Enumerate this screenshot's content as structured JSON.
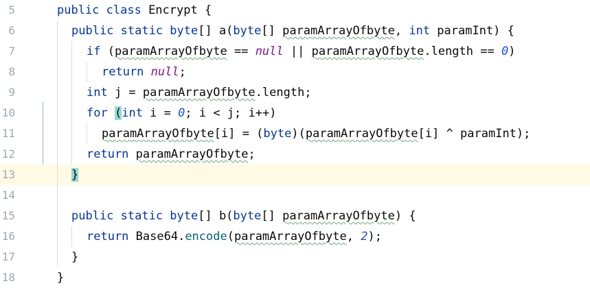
{
  "editor": {
    "language": "java",
    "current_line": 13,
    "lines": [
      {
        "n": "5",
        "text": "public class Encrypt {"
      },
      {
        "n": "6",
        "text": "public static byte[] a(byte[] paramArrayOfbyte, int paramInt) {"
      },
      {
        "n": "7",
        "text": "if (paramArrayOfbyte == null || paramArrayOfbyte.length == 0)"
      },
      {
        "n": "8",
        "text": "return null;"
      },
      {
        "n": "9",
        "text": "int j = paramArrayOfbyte.length;"
      },
      {
        "n": "10",
        "text": "for (int i = 0; i < j; i++)"
      },
      {
        "n": "11",
        "text": "paramArrayOfbyte[i] = (byte)(paramArrayOfbyte[i] ^ paramInt);"
      },
      {
        "n": "12",
        "text": "return paramArrayOfbyte;"
      },
      {
        "n": "13",
        "text": "}"
      },
      {
        "n": "14",
        "text": ""
      },
      {
        "n": "15",
        "text": "public static byte[] b(byte[] paramArrayOfbyte) {"
      },
      {
        "n": "16",
        "text": "return Base64.encode(paramArrayOfbyte, 2);"
      },
      {
        "n": "17",
        "text": "}"
      },
      {
        "n": "18",
        "text": "}"
      }
    ]
  },
  "colors": {
    "keyword": "#0033b3",
    "number": "#1750eb",
    "null_keyword": "#871094",
    "method_call": "#00627a",
    "current_line_bg": "#fffae3",
    "brace_match_bg": "#93d9d9",
    "line_number": "#a0a7b1"
  }
}
